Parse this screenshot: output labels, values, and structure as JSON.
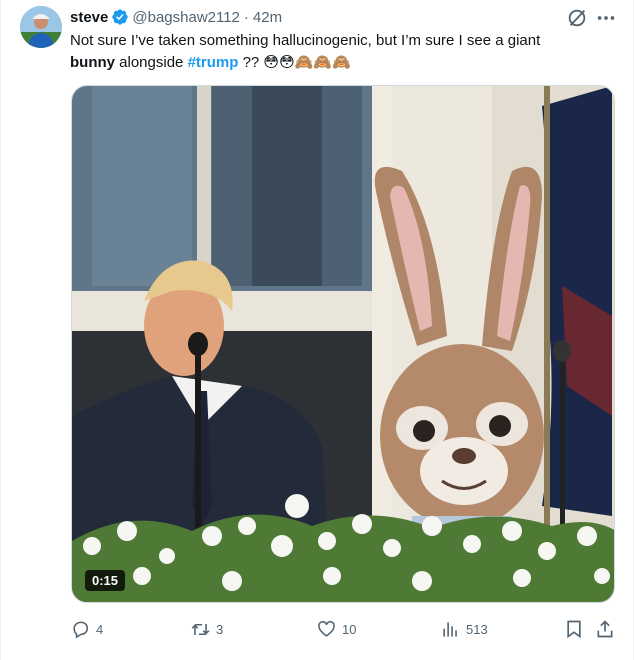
{
  "tweet": {
    "display_name": "steve",
    "handle": "@bagshaw2112",
    "separator": "·",
    "time": "42m",
    "text_line1": "Not sure I’ve taken something hallucinogenic, but I’m sure I see a giant",
    "text_bold": "bunny",
    "text_mid": " alongside ",
    "hashtag": "#trump",
    "text_end": " ?? 😳😳🙈🙈🙈"
  },
  "media": {
    "duration": "0:15"
  },
  "actions": {
    "replies": "4",
    "reposts": "3",
    "likes": "10",
    "views": "513"
  },
  "icons": [
    "verified-badge-icon",
    "grok-icon",
    "more-icon",
    "reply-icon",
    "repost-icon",
    "like-icon",
    "views-icon",
    "bookmark-icon",
    "share-icon"
  ],
  "colors": {
    "accent": "#1d9bf0",
    "text": "#0f1419",
    "muted": "#536471",
    "border": "#cfd9de"
  }
}
